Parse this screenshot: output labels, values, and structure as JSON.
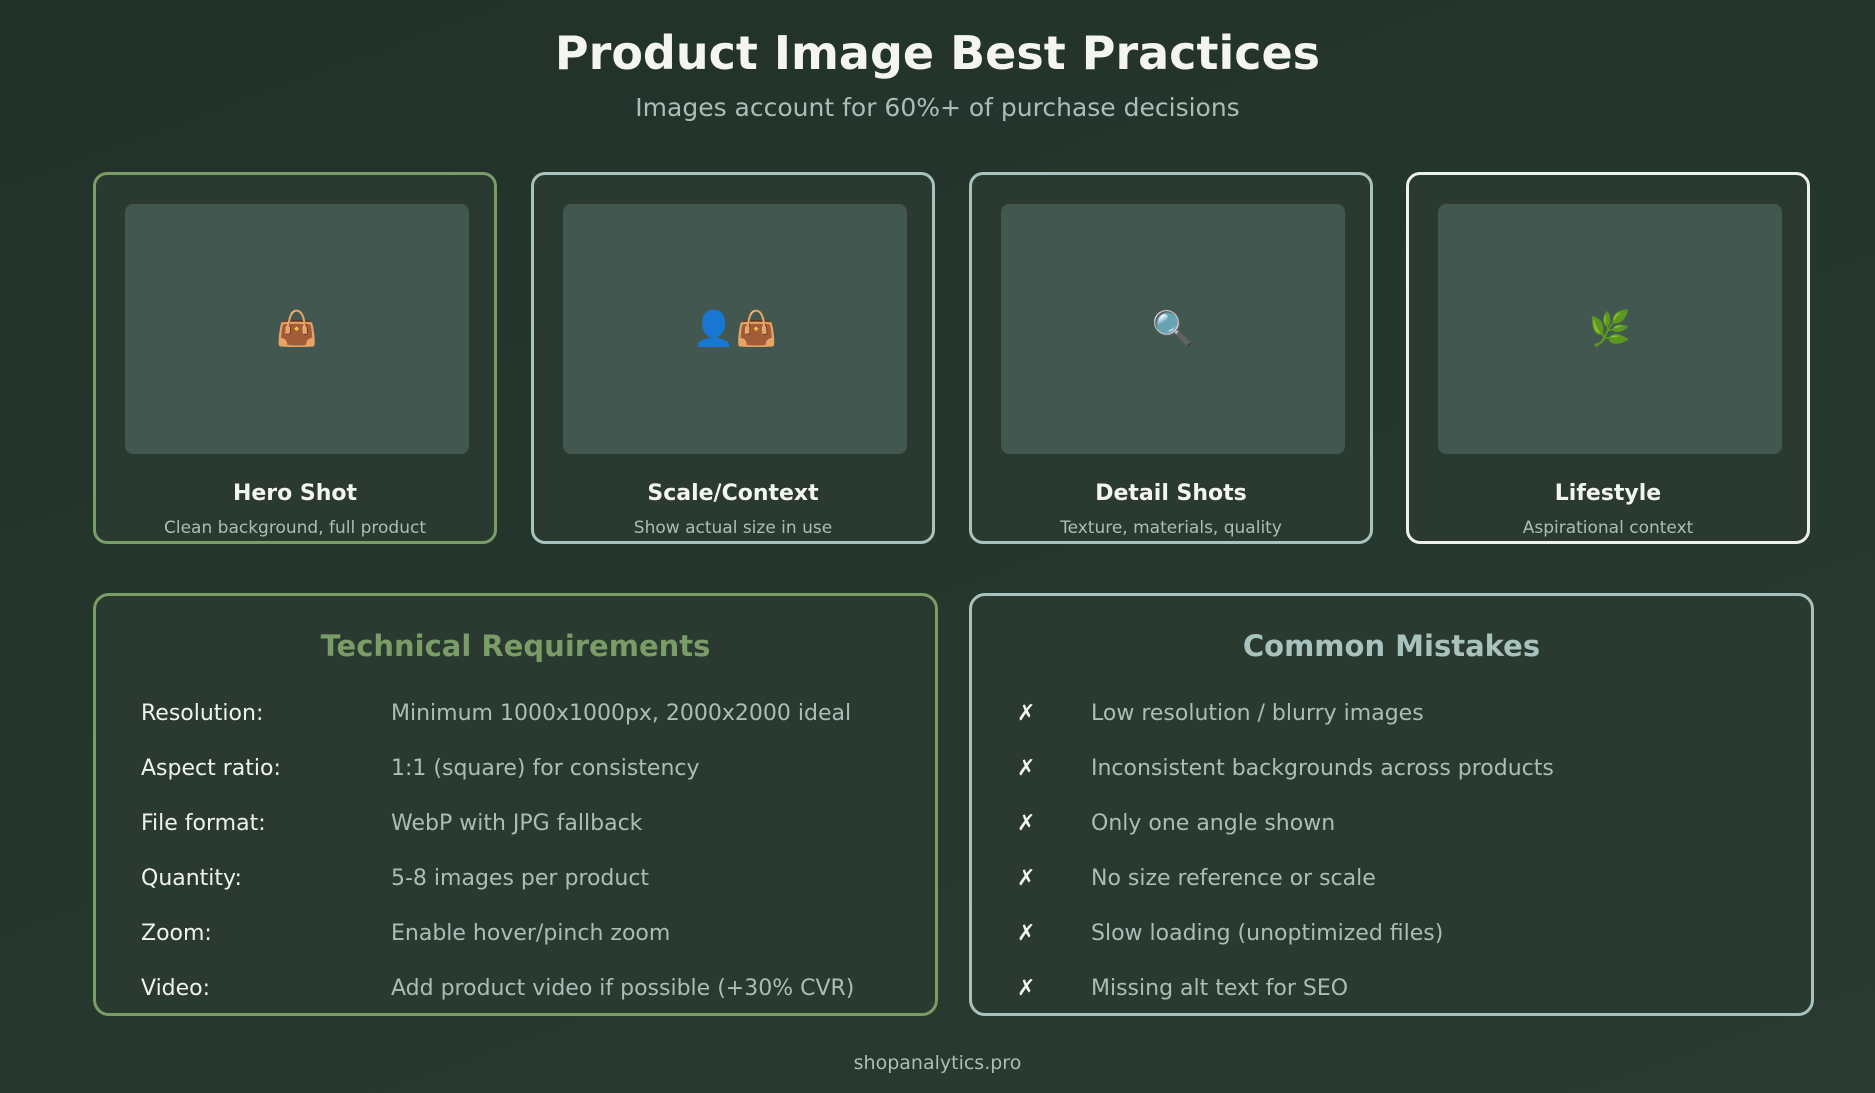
{
  "header": {
    "title": "Product Image Best Practices",
    "subtitle": "Images account for 60%+ of purchase decisions"
  },
  "cards": [
    {
      "icon": "👜",
      "icon_name": "handbag-icon",
      "title": "Hero Shot",
      "desc": "Clean background, full product",
      "border_color": "#7a9c66"
    },
    {
      "icon": "👤👜",
      "icon_name": "person-with-bag-icon",
      "title": "Scale/Context",
      "desc": "Show actual size in use",
      "border_color": "#a8c2bd"
    },
    {
      "icon": "🔍",
      "icon_name": "magnifier-icon",
      "title": "Detail Shots",
      "desc": "Texture, materials, quality",
      "border_color": "#a8c2bd"
    },
    {
      "icon": "🌿",
      "icon_name": "herb-icon",
      "title": "Lifestyle",
      "desc": "Aspirational context",
      "border_color": "#eef0ec"
    }
  ],
  "technical": {
    "title": "Technical Requirements",
    "rows": [
      {
        "label": "Resolution:",
        "value": "Minimum 1000x1000px, 2000x2000 ideal"
      },
      {
        "label": "Aspect ratio:",
        "value": "1:1 (square) for consistency"
      },
      {
        "label": "File format:",
        "value": "WebP with JPG fallback"
      },
      {
        "label": "Quantity:",
        "value": "5-8 images per product"
      },
      {
        "label": "Zoom:",
        "value": "Enable hover/pinch zoom"
      },
      {
        "label": "Video:",
        "value": "Add product video if possible (+30% CVR)"
      }
    ]
  },
  "mistakes": {
    "title": "Common Mistakes",
    "mark": "✗",
    "items": [
      "Low resolution / blurry images",
      "Inconsistent backgrounds across products",
      "Only one angle shown",
      "No size reference or scale",
      "Slow loading (unoptimized files)",
      "Missing alt text for SEO"
    ]
  },
  "footer": "shopanalytics.pro",
  "colors": {
    "accent_green": "#7a9c66",
    "accent_blue": "#a8c2bd",
    "background": "#25372d"
  }
}
